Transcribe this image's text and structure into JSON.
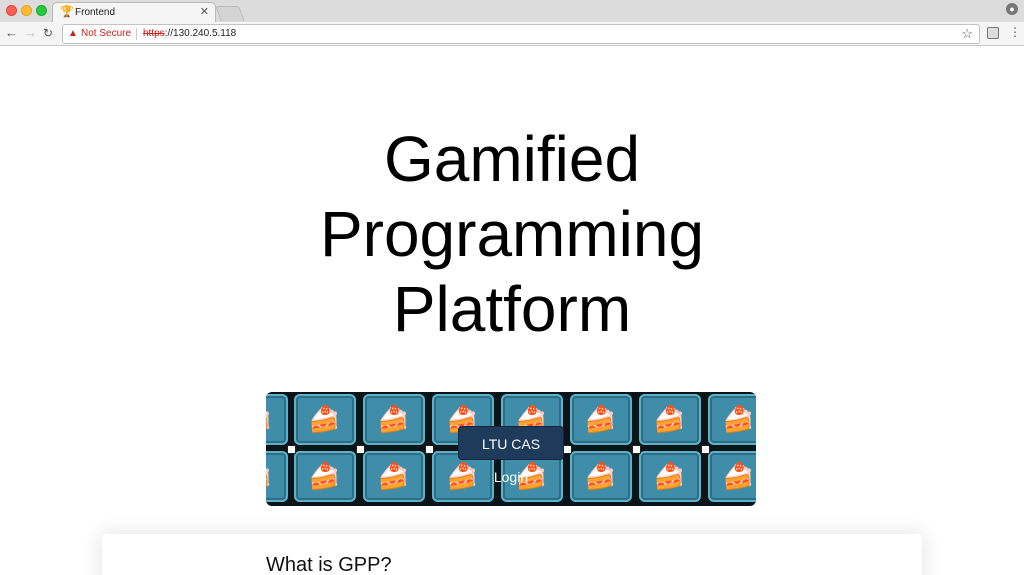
{
  "browser": {
    "tab_title": "Frontend",
    "tab_favicon": "trophy-icon",
    "security_label": "Not Secure",
    "url_scheme": "https",
    "url_rest": "://130.240.5.118"
  },
  "page": {
    "title": "Gamified Programming Platform",
    "login_button": "LTU CAS Login",
    "section_heading": "What is GPP?"
  },
  "colors": {
    "banner_tile": "#3f8da8",
    "login_button_bg": "#1f3b5c",
    "not_secure": "#c5221f"
  }
}
